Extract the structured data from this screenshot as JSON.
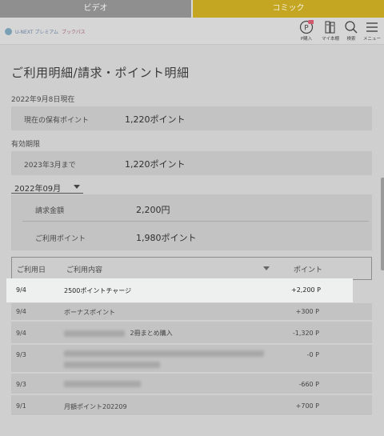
{
  "tabs": {
    "video": "ビデオ",
    "comic": "コミック"
  },
  "header": {
    "logo_a": "U-NEXT プレミアム",
    "logo_b": "ブックパス",
    "buttons": [
      {
        "label": "P購入",
        "badge": ""
      },
      {
        "label": "マイ本棚"
      },
      {
        "label": "検索"
      },
      {
        "label": "メニュー"
      }
    ]
  },
  "title": "ご利用明細/請求・ポイント明細",
  "as_of": "2022年9月8日現在",
  "holdings": {
    "key": "現在の保有ポイント",
    "value": "1,220ポイント"
  },
  "expiry": {
    "label": "有効期限",
    "key": "2023年3月まで",
    "value": "1,220ポイント"
  },
  "month": "2022年09月",
  "summary": {
    "billing_key": "請求金額",
    "billing_value": "2,200円",
    "used_key": "ご利用ポイント",
    "used_value": "1,980ポイント"
  },
  "table": {
    "headers": {
      "date": "ご利用日",
      "desc": "ご利用内容",
      "points": "ポイント"
    },
    "highlight": {
      "date": "9/4",
      "desc": "2500ポイントチャージ",
      "amount": "+2,200 P"
    },
    "rows": [
      {
        "date": "9/4",
        "desc": "ボーナスポイント",
        "amount": "+300 P"
      },
      {
        "date": "9/4",
        "desc": "2冊まとめ購入",
        "amount": "-1,320 P"
      },
      {
        "date": "9/3",
        "desc": "",
        "amount": "-0 P"
      },
      {
        "date": "9/3",
        "desc": "",
        "amount": "-660 P"
      },
      {
        "date": "9/1",
        "desc": "月額ポイント202209",
        "amount": "+700 P"
      }
    ]
  }
}
